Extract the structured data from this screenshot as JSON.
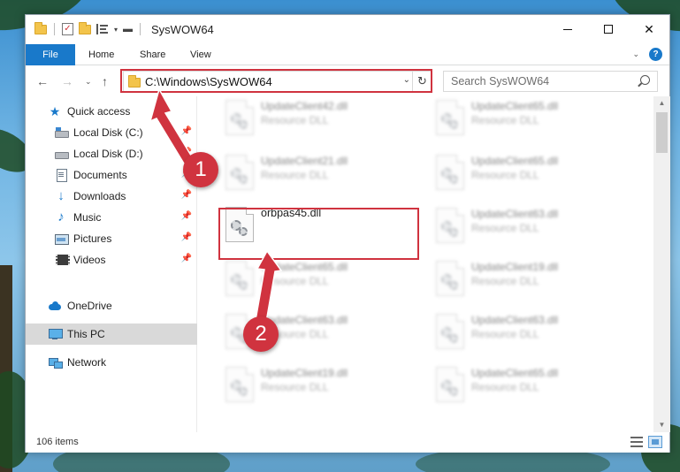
{
  "window": {
    "title": "SysWOW64",
    "minimize_label": "–",
    "maximize_label": "",
    "close_label": "✕"
  },
  "ribbon": {
    "tabs": [
      "File",
      "Home",
      "Share",
      "View"
    ],
    "help_label": "?"
  },
  "address_bar": {
    "path": "C:\\Windows\\SysWOW64"
  },
  "search": {
    "placeholder": "Search SysWOW64"
  },
  "sidebar": {
    "items": [
      {
        "label": "Quick access",
        "icon": "star-icon",
        "pinned": false
      },
      {
        "label": "Local Disk (C:)",
        "icon": "drive-icon",
        "pinned": true
      },
      {
        "label": "Local Disk (D:)",
        "icon": "drive-icon",
        "pinned": true
      },
      {
        "label": "Documents",
        "icon": "documents-icon",
        "pinned": true
      },
      {
        "label": "Downloads",
        "icon": "downloads-icon",
        "pinned": true
      },
      {
        "label": "Music",
        "icon": "music-icon",
        "pinned": true
      },
      {
        "label": "Pictures",
        "icon": "pictures-icon",
        "pinned": true
      },
      {
        "label": "Videos",
        "icon": "videos-icon",
        "pinned": true
      },
      {
        "label": "OneDrive",
        "icon": "onedrive-icon",
        "pinned": false
      },
      {
        "label": "This PC",
        "icon": "this-pc-icon",
        "pinned": false,
        "selected": true
      },
      {
        "label": "Network",
        "icon": "network-icon",
        "pinned": false
      }
    ]
  },
  "files": {
    "left_column": [
      {
        "name": "UpdateClient42.dll",
        "type": "Resource DLL"
      },
      {
        "name": "UpdateClient21.dll",
        "type": "Resource DLL"
      },
      {
        "name": "orbpas45.dll",
        "type": ""
      },
      {
        "name": "UpdateClient65.dll",
        "type": "Resource DLL"
      },
      {
        "name": "UpdateClient63.dll",
        "type": "Resource DLL"
      },
      {
        "name": "UpdateClient19.dll",
        "type": "Resource DLL"
      }
    ],
    "right_column": [
      {
        "name": "UpdateClient65.dll",
        "type": "Resource DLL"
      },
      {
        "name": "UpdateClient65.dll",
        "type": "Resource DLL"
      },
      {
        "name": "UpdateClient63.dll",
        "type": "Resource DLL"
      },
      {
        "name": "UpdateClient19.dll",
        "type": "Resource DLL"
      },
      {
        "name": "UpdateClient63.dll",
        "type": "Resource DLL"
      },
      {
        "name": "UpdateClient65.dll",
        "type": "Resource DLL"
      }
    ]
  },
  "status_bar": {
    "item_count": "106 items"
  },
  "annotations": {
    "step1": "1",
    "step2": "2",
    "color": "#d0333f"
  },
  "colors": {
    "accent": "#1979ca",
    "selected_bg": "#d9d9d9"
  }
}
